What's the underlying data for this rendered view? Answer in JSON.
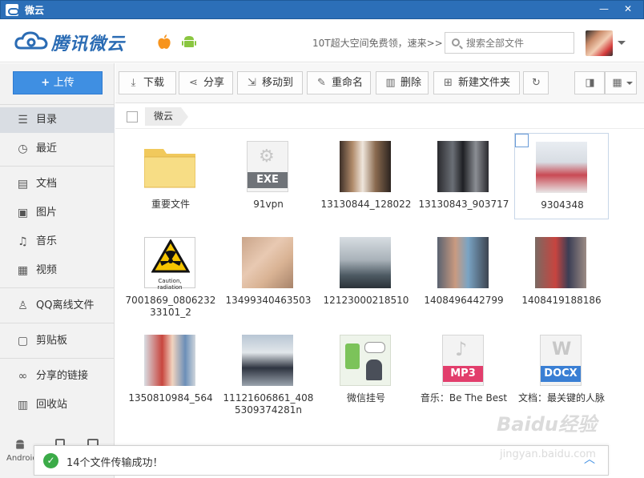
{
  "window": {
    "title": "微云",
    "minimize": "—",
    "close": "✕"
  },
  "header": {
    "brand": "腾讯微云",
    "promo": "10T超大空间免费领，速来>>",
    "search_placeholder": "搜索全部文件"
  },
  "sidebar": {
    "upload_label": "上传",
    "items": [
      {
        "label": "目录",
        "icon": "list-icon"
      },
      {
        "label": "最近",
        "icon": "clock-icon"
      },
      {
        "label": "文档",
        "icon": "document-icon"
      },
      {
        "label": "图片",
        "icon": "image-icon"
      },
      {
        "label": "音乐",
        "icon": "music-icon"
      },
      {
        "label": "视频",
        "icon": "video-icon"
      },
      {
        "label": "QQ离线文件",
        "icon": "qq-icon"
      },
      {
        "label": "剪贴板",
        "icon": "clipboard-icon"
      },
      {
        "label": "分享的链接",
        "icon": "link-icon"
      },
      {
        "label": "回收站",
        "icon": "trash-icon"
      }
    ],
    "android_label": "Android"
  },
  "toolbar": {
    "download": "下载",
    "share": "分享",
    "move": "移动到",
    "rename": "重命名",
    "delete": "删除",
    "new_folder": "新建文件夹"
  },
  "breadcrumb": {
    "current": "微云"
  },
  "files": [
    {
      "name": "重要文件",
      "kind": "folder"
    },
    {
      "name": "91vpn",
      "kind": "exe",
      "badge": "EXE"
    },
    {
      "name": "13130844_128022",
      "kind": "photo"
    },
    {
      "name": "13130843_903717",
      "kind": "photo"
    },
    {
      "name": "9304348",
      "kind": "photo",
      "selected": true
    },
    {
      "name": "7001869_080623233101_2",
      "kind": "photo",
      "caption": "Caution, radiation"
    },
    {
      "name": "13499340463503",
      "kind": "photo"
    },
    {
      "name": "12123000218510",
      "kind": "photo"
    },
    {
      "name": "1408496442799",
      "kind": "photo"
    },
    {
      "name": "1408419188186",
      "kind": "photo"
    },
    {
      "name": "1350810984_564",
      "kind": "photo"
    },
    {
      "name": "11121606861_4085309374281n",
      "kind": "photo"
    },
    {
      "name": "微信挂号",
      "kind": "photo"
    },
    {
      "name": "音乐：Be The Best",
      "kind": "mp3",
      "badge": "MP3"
    },
    {
      "name": "文档：最关键的人脉",
      "kind": "docx",
      "badge": "DOCX"
    }
  ],
  "status": {
    "message": "14个文件传输成功！"
  },
  "watermark": {
    "main": "Baidu经验",
    "sub": "jingyan.baidu.com"
  },
  "colors": {
    "accent": "#3f8fe2",
    "titlebar": "#2c6fb8",
    "success": "#3bab48",
    "mp3": "#e23e6c",
    "docx": "#3a7fd4"
  }
}
